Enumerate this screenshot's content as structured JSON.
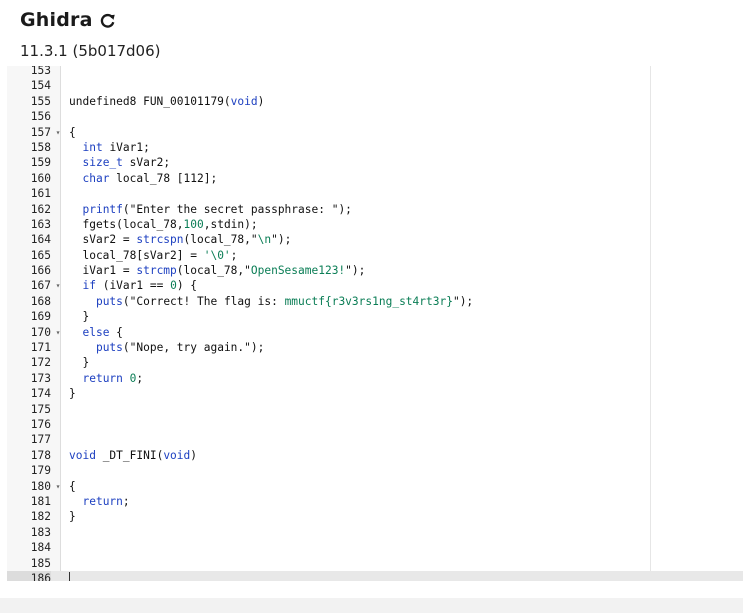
{
  "header": {
    "title": "Ghidra",
    "refresh_icon": "refresh-icon",
    "version": "11.3.1 (5b017d06)"
  },
  "colors": {
    "keyword": "#1c3fc0",
    "string": "#0a7d55",
    "text": "#111111",
    "gutter_bg": "#f7f7f7",
    "active_line_bg": "#e8e8e8"
  },
  "editor": {
    "lines": [
      {
        "n": "153",
        "fold": false,
        "segs": []
      },
      {
        "n": "154",
        "fold": false,
        "segs": []
      },
      {
        "n": "155",
        "fold": false,
        "segs": [
          {
            "t": "undefined8 FUN_00101179(",
            "c": ""
          },
          {
            "t": "void",
            "c": "kw"
          },
          {
            "t": ")",
            "c": ""
          }
        ]
      },
      {
        "n": "156",
        "fold": false,
        "segs": []
      },
      {
        "n": "157",
        "fold": true,
        "segs": [
          {
            "t": "{",
            "c": ""
          }
        ]
      },
      {
        "n": "158",
        "fold": false,
        "segs": [
          {
            "t": "  ",
            "c": ""
          },
          {
            "t": "int",
            "c": "kw"
          },
          {
            "t": " iVar1;",
            "c": ""
          }
        ]
      },
      {
        "n": "159",
        "fold": false,
        "segs": [
          {
            "t": "  ",
            "c": ""
          },
          {
            "t": "size_t",
            "c": "kw"
          },
          {
            "t": " sVar2;",
            "c": ""
          }
        ]
      },
      {
        "n": "160",
        "fold": false,
        "segs": [
          {
            "t": "  ",
            "c": ""
          },
          {
            "t": "char",
            "c": "kw"
          },
          {
            "t": " local_78 [112];",
            "c": ""
          }
        ]
      },
      {
        "n": "161",
        "fold": false,
        "segs": []
      },
      {
        "n": "162",
        "fold": false,
        "segs": [
          {
            "t": "  ",
            "c": ""
          },
          {
            "t": "printf",
            "c": "kw"
          },
          {
            "t": "(\"Enter the secret passphrase: \");",
            "c": ""
          }
        ]
      },
      {
        "n": "163",
        "fold": false,
        "segs": [
          {
            "t": "  fgets(local_78,",
            "c": ""
          },
          {
            "t": "100",
            "c": "num"
          },
          {
            "t": ",stdin);",
            "c": ""
          }
        ]
      },
      {
        "n": "164",
        "fold": false,
        "segs": [
          {
            "t": "  sVar2 = ",
            "c": ""
          },
          {
            "t": "strcspn",
            "c": "kw"
          },
          {
            "t": "(local_78,\"",
            "c": ""
          },
          {
            "t": "\\n",
            "c": "str"
          },
          {
            "t": "\");",
            "c": ""
          }
        ]
      },
      {
        "n": "165",
        "fold": false,
        "segs": [
          {
            "t": "  local_78[sVar2] = ",
            "c": ""
          },
          {
            "t": "'\\0'",
            "c": "str"
          },
          {
            "t": ";",
            "c": ""
          }
        ]
      },
      {
        "n": "166",
        "fold": false,
        "segs": [
          {
            "t": "  iVar1 = ",
            "c": ""
          },
          {
            "t": "strcmp",
            "c": "kw"
          },
          {
            "t": "(local_78,\"",
            "c": ""
          },
          {
            "t": "OpenSesame123!",
            "c": "str"
          },
          {
            "t": "\");",
            "c": ""
          }
        ]
      },
      {
        "n": "167",
        "fold": true,
        "segs": [
          {
            "t": "  ",
            "c": ""
          },
          {
            "t": "if",
            "c": "kw"
          },
          {
            "t": " (iVar1 == ",
            "c": ""
          },
          {
            "t": "0",
            "c": "num"
          },
          {
            "t": ") {",
            "c": ""
          }
        ]
      },
      {
        "n": "168",
        "fold": false,
        "segs": [
          {
            "t": "    ",
            "c": ""
          },
          {
            "t": "puts",
            "c": "kw"
          },
          {
            "t": "(\"Correct! The flag is: ",
            "c": ""
          },
          {
            "t": "mmuctf{r3v3rs1ng_st4rt3r}",
            "c": "str"
          },
          {
            "t": "\");",
            "c": ""
          }
        ]
      },
      {
        "n": "169",
        "fold": false,
        "segs": [
          {
            "t": "  }",
            "c": ""
          }
        ]
      },
      {
        "n": "170",
        "fold": true,
        "segs": [
          {
            "t": "  ",
            "c": ""
          },
          {
            "t": "else",
            "c": "kw"
          },
          {
            "t": " {",
            "c": ""
          }
        ]
      },
      {
        "n": "171",
        "fold": false,
        "segs": [
          {
            "t": "    ",
            "c": ""
          },
          {
            "t": "puts",
            "c": "kw"
          },
          {
            "t": "(\"Nope, try again.\");",
            "c": ""
          }
        ]
      },
      {
        "n": "172",
        "fold": false,
        "segs": [
          {
            "t": "  }",
            "c": ""
          }
        ]
      },
      {
        "n": "173",
        "fold": false,
        "segs": [
          {
            "t": "  ",
            "c": ""
          },
          {
            "t": "return",
            "c": "kw"
          },
          {
            "t": " ",
            "c": ""
          },
          {
            "t": "0",
            "c": "num"
          },
          {
            "t": ";",
            "c": ""
          }
        ]
      },
      {
        "n": "174",
        "fold": false,
        "segs": [
          {
            "t": "}",
            "c": ""
          }
        ]
      },
      {
        "n": "175",
        "fold": false,
        "segs": []
      },
      {
        "n": "176",
        "fold": false,
        "segs": []
      },
      {
        "n": "177",
        "fold": false,
        "segs": []
      },
      {
        "n": "178",
        "fold": false,
        "segs": [
          {
            "t": "void",
            "c": "kw"
          },
          {
            "t": " _DT_FINI(",
            "c": ""
          },
          {
            "t": "void",
            "c": "kw"
          },
          {
            "t": ")",
            "c": ""
          }
        ]
      },
      {
        "n": "179",
        "fold": false,
        "segs": []
      },
      {
        "n": "180",
        "fold": true,
        "segs": [
          {
            "t": "{",
            "c": ""
          }
        ]
      },
      {
        "n": "181",
        "fold": false,
        "segs": [
          {
            "t": "  ",
            "c": ""
          },
          {
            "t": "return",
            "c": "kw"
          },
          {
            "t": ";",
            "c": ""
          }
        ]
      },
      {
        "n": "182",
        "fold": false,
        "segs": [
          {
            "t": "}",
            "c": ""
          }
        ]
      },
      {
        "n": "183",
        "fold": false,
        "segs": []
      },
      {
        "n": "184",
        "fold": false,
        "segs": []
      },
      {
        "n": "185",
        "fold": false,
        "segs": []
      },
      {
        "n": "186",
        "fold": false,
        "active": true,
        "segs": []
      }
    ]
  }
}
